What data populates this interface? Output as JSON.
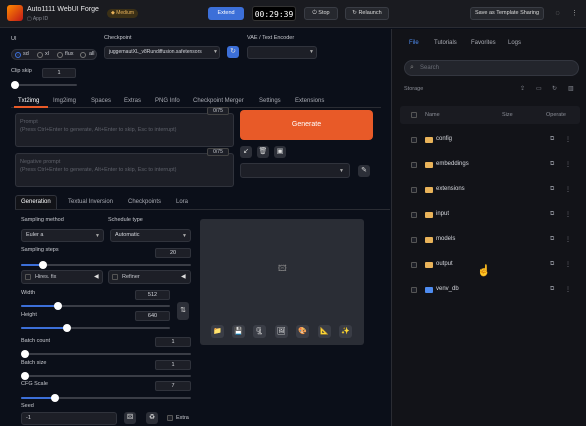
{
  "header": {
    "title": "Auto1111 WebUI Forge",
    "app_id": "App ID",
    "tier_badge": "Medium",
    "extend_label": "Extend",
    "timer": "00:29:39",
    "stop_label": "Stop",
    "relaunch_label": "Relaunch",
    "template_label": "Save as Template Sharing",
    "accent_color": "#3c6fd8",
    "brand_color": "#e85a28"
  },
  "ui_section": {
    "label": "UI",
    "options": [
      "sd",
      "xl",
      "flux",
      "all"
    ],
    "selected": "sd"
  },
  "checkpoint": {
    "label": "Checkpoint",
    "value": "juggernautXL_v8Rundiffusion.safetensors"
  },
  "vae": {
    "label": "VAE / Text Encoder",
    "value": ""
  },
  "clip_skip": {
    "label": "Clip skip",
    "value": "1"
  },
  "main_tabs": [
    "Txt2img",
    "Img2img",
    "Spaces",
    "Extras",
    "PNG Info",
    "Checkpoint Merger",
    "Settings",
    "Extensions"
  ],
  "prompt": {
    "placeholder": "Prompt\n(Press Ctrl+Enter to generate, Alt+Enter to skip, Esc to interrupt)",
    "counter": "0/75"
  },
  "negative_prompt": {
    "placeholder": "Negative prompt\n(Press Ctrl+Enter to generate, Alt+Enter to skip, Esc to interrupt)",
    "counter": "0/75"
  },
  "generate_label": "Generate",
  "sub_tabs": [
    "Generation",
    "Textual Inversion",
    "Checkpoints",
    "Lora"
  ],
  "sampling": {
    "method_label": "Sampling method",
    "method_value": "Euler a",
    "schedule_label": "Schedule type",
    "schedule_value": "Automatic",
    "steps_label": "Sampling steps",
    "steps_value": "20",
    "steps_fraction": 0.13
  },
  "hires_fix": {
    "label": "Hires. fix"
  },
  "refiner": {
    "label": "Refiner"
  },
  "width": {
    "label": "Width",
    "value": "512",
    "fraction": 0.25
  },
  "height": {
    "label": "Height",
    "value": "640",
    "fraction": 0.31
  },
  "batch_count": {
    "label": "Batch count",
    "value": "1",
    "fraction": 0.0
  },
  "batch_size": {
    "label": "Batch size",
    "value": "1",
    "fraction": 0.0
  },
  "cfg_scale": {
    "label": "CFG Scale",
    "value": "7",
    "fraction": 0.2
  },
  "seed": {
    "label": "Seed",
    "value": "-1",
    "extra_label": "Extra"
  },
  "file_panel": {
    "tabs": [
      "File",
      "Tutorials",
      "Favorites",
      "Logs"
    ],
    "active_tab": "File",
    "search_placeholder": "Search",
    "storage_label": "Storage",
    "columns": [
      "Name",
      "Size",
      "Operate"
    ],
    "rows": [
      {
        "name": "config",
        "type": "folder"
      },
      {
        "name": "embeddings",
        "type": "folder"
      },
      {
        "name": "extensions",
        "type": "folder"
      },
      {
        "name": "input",
        "type": "folder"
      },
      {
        "name": "models",
        "type": "folder"
      },
      {
        "name": "output",
        "type": "folder"
      },
      {
        "name": "venv_db",
        "type": "folder-blue"
      }
    ]
  }
}
